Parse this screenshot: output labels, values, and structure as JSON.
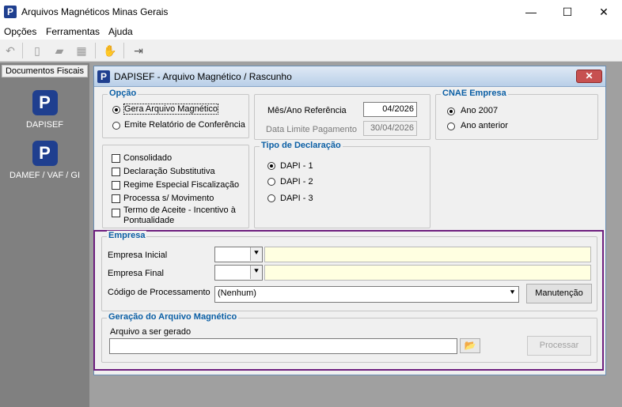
{
  "app": {
    "title": "Arquivos Magnéticos Minas Gerais",
    "logo_letter": "P"
  },
  "window_controls": {
    "minimize": "—",
    "maximize": "☐",
    "close": "✕"
  },
  "menu": [
    "Opções",
    "Ferramentas",
    "Ajuda"
  ],
  "toolbar_icons": [
    "undo-icon",
    "page-icon",
    "print-icon",
    "print-setup-icon",
    "handshake-icon",
    "exit-door-icon"
  ],
  "toolbar_glyphs": {
    "undo": "↶",
    "page": "▯",
    "print": "▰",
    "print_setup": "▦",
    "handshake": "✋",
    "exit": "⇥"
  },
  "sidebar": {
    "header": "Documentos Fiscais",
    "items": [
      {
        "label": "DAPISEF",
        "icon": "P"
      },
      {
        "label": "DAMEF / VAF / GI",
        "icon": "P"
      }
    ]
  },
  "child": {
    "title": "DAPISEF - Arquivo Magnético / Rascunho",
    "close": "✕",
    "opcao": {
      "legend": "Opção",
      "options": [
        "Gera Arquivo Magnético",
        "Emite Relatório de Conferência"
      ],
      "selected": 0
    },
    "referencia": {
      "mes_ano_label": "Mês/Ano Referência",
      "mes_ano_value": "04/2026",
      "data_limite_label": "Data Limite Pagamento",
      "data_limite_value": "30/04/2026"
    },
    "cnae": {
      "legend": "CNAE Empresa",
      "options": [
        "Ano 2007",
        "Ano anterior"
      ],
      "selected": 0
    },
    "flags": [
      "Consolidado",
      "Declaração Substitutiva",
      "Regime Especial Fiscalização",
      "Processa s/ Movimento",
      "Termo de Aceite - Incentivo à",
      "Pontualidade"
    ],
    "tipo": {
      "legend": "Tipo de Declaração",
      "options": [
        "DAPI - 1",
        "DAPI - 2",
        "DAPI - 3"
      ],
      "selected": 0
    },
    "empresa": {
      "legend": "Empresa",
      "inicial_label": "Empresa Inicial",
      "final_label": "Empresa Final",
      "codigo_label": "Código de Processamento",
      "codigo_value": "(Nenhum)",
      "manutencao_button": "Manutenção",
      "dropdown_glyph": "⯆"
    },
    "geracao": {
      "legend": "Geração do Arquivo Magnético",
      "arquivo_label": "Arquivo a ser gerado",
      "arquivo_value": "",
      "processar_button": "Processar",
      "folder_glyph": "📂"
    }
  }
}
